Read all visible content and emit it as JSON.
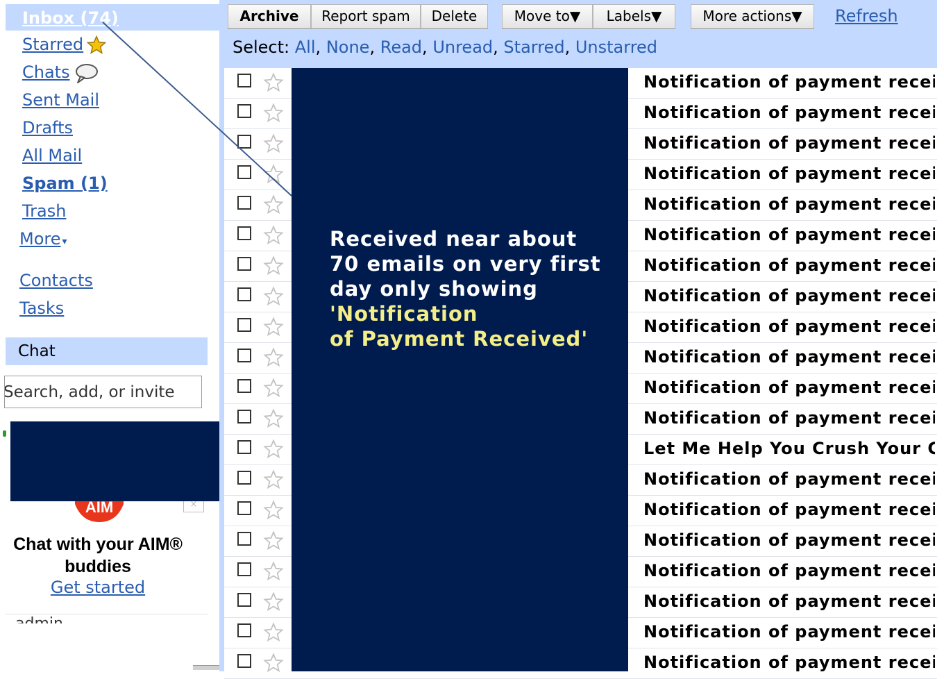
{
  "sidebar": {
    "inbox_label": "Inbox (74)",
    "items": [
      {
        "label": "Starred",
        "bold": false
      },
      {
        "label": "Chats",
        "bold": false
      },
      {
        "label": "Sent Mail",
        "bold": false
      },
      {
        "label": "Drafts",
        "bold": false
      },
      {
        "label": "All Mail",
        "bold": false
      },
      {
        "label": "Spam (1)",
        "bold": true
      },
      {
        "label": "Trash",
        "bold": false
      },
      {
        "label": "More",
        "bold": false
      }
    ],
    "more_arrow": "▾",
    "contacts_label": "Contacts",
    "tasks_label": "Tasks"
  },
  "chat": {
    "title": "Chat",
    "search_placeholder": "Search, add, or invite",
    "aim_logo_text": "AIM",
    "aim_close": "×",
    "promo_line1": "Chat with your AIM®",
    "promo_line2": "buddies",
    "get_started_label": "Get started",
    "admin_label": "admin"
  },
  "toolbar": {
    "archive_label": "Archive",
    "report_spam_label": "Report spam",
    "delete_label": "Delete",
    "move_to_label": "Move to▼",
    "labels_label": "Labels▼",
    "more_actions_label": "More actions▼",
    "refresh_label": "Refresh"
  },
  "select_bar": {
    "label": "Select:",
    "options": [
      "All",
      "None",
      "Read",
      "Unread",
      "Starred",
      "Unstarred"
    ]
  },
  "emails": [
    {
      "subject": "Notification of payment received"
    },
    {
      "subject": "Notification of payment received"
    },
    {
      "subject": "Notification of payment received"
    },
    {
      "subject": "Notification of payment received"
    },
    {
      "subject": "Notification of payment received"
    },
    {
      "subject": "Notification of payment received"
    },
    {
      "subject": "Notification of payment received"
    },
    {
      "subject": "Notification of payment received"
    },
    {
      "subject": "Notification of payment received"
    },
    {
      "subject": "Notification of payment received"
    },
    {
      "subject": "Notification of payment received"
    },
    {
      "subject": "Notification of payment received"
    },
    {
      "subject": "Let Me Help You Crush Your Com"
    },
    {
      "subject": "Notification of payment received"
    },
    {
      "subject": "Notification of payment received"
    },
    {
      "subject": "Notification of payment received"
    },
    {
      "subject": "Notification of payment received"
    },
    {
      "subject": "Notification of payment received"
    },
    {
      "subject": "Notification of payment received"
    },
    {
      "subject": "Notification of payment received"
    }
  ],
  "annotation": {
    "line1": "Received near about",
    "line2": "70 emails on very first",
    "line3": "day only showing",
    "line4": "'Notification",
    "line5": "of Payment Received'"
  },
  "colors": {
    "selection_blue": "#c3d9ff",
    "link_blue": "#2a5db0",
    "overlay_navy": "#001c4e",
    "caption_yellow": "#f4ee88",
    "pointer_line": "#3c5a8c",
    "star_gold": "#f4c20d"
  },
  "icons": {
    "starred": "star-icon",
    "chats": "speech-bubble-icon",
    "row_star": "star-outline-icon",
    "row_checkbox": "checkbox-icon"
  }
}
